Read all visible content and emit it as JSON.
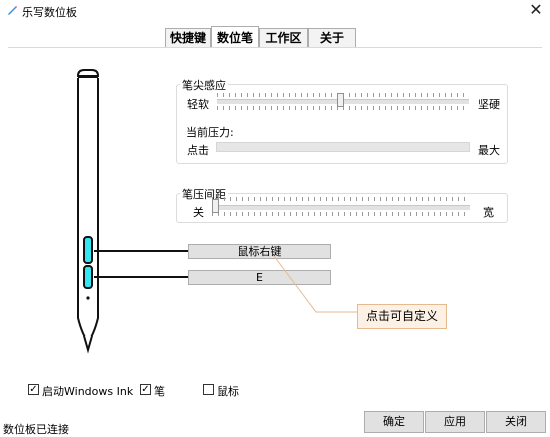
{
  "window": {
    "title": "乐写数位板",
    "close_glyph": "✕"
  },
  "tabs": [
    {
      "label": "快捷键",
      "active": false
    },
    {
      "label": "数位笔",
      "active": true
    },
    {
      "label": "工作区",
      "active": false
    },
    {
      "label": "关于",
      "active": false
    }
  ],
  "tip_sensitivity": {
    "title": "笔尖感应",
    "left_label": "轻软",
    "right_label": "坚硬",
    "value_fraction": 0.49,
    "current_pressure_label": "当前压力:",
    "pressure_left": "点击",
    "pressure_right": "最大",
    "current_pressure_fraction": 0
  },
  "pen_distance": {
    "title": "笔压间距",
    "left_label": "关",
    "right_label": "宽",
    "value_fraction": 0.0
  },
  "pen_buttons": {
    "upper_value": "鼠标右键",
    "lower_value": "E"
  },
  "callout": {
    "text": "点击可自定义"
  },
  "options": {
    "windows_ink": {
      "label": "启动Windows Ink",
      "checked": true
    },
    "pen": {
      "label": "笔",
      "checked": true
    },
    "mouse": {
      "label": "鼠标",
      "checked": false
    },
    "check_glyph": "✓"
  },
  "status": {
    "text": "数位板已连接"
  },
  "buttons": {
    "ok": "确定",
    "apply": "应用",
    "close": "关闭"
  },
  "colors": {
    "pen_accent": "#35e6f2",
    "callout_bg": "#fdf1e6"
  }
}
